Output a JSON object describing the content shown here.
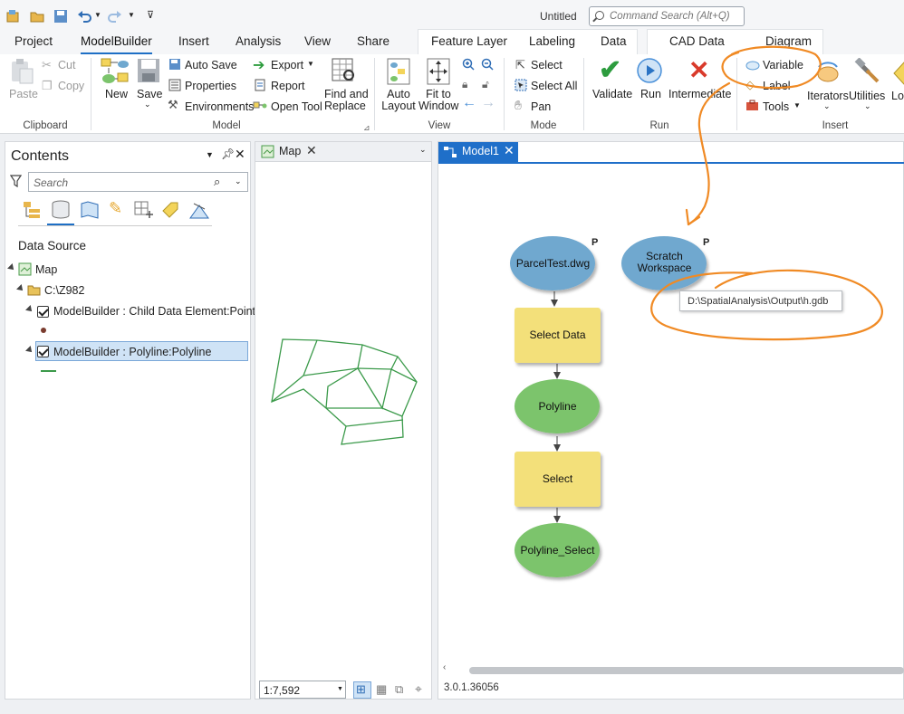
{
  "window": {
    "title": "Untitled",
    "command_search_placeholder": "Command Search (Alt+Q)"
  },
  "tabs": [
    "Project",
    "ModelBuilder",
    "Insert",
    "Analysis",
    "View",
    "Share"
  ],
  "contextual_tabs": {
    "feature_layer": "Feature Layer",
    "labeling": "Labeling",
    "data": "Data",
    "cad_data": "CAD Data",
    "diagram": "Diagram"
  },
  "ribbon": {
    "clipboard": {
      "paste": "Paste",
      "cut": "Cut",
      "copy": "Copy",
      "group": "Clipboard"
    },
    "model": {
      "new": "New",
      "save": "Save",
      "auto_save": "Auto Save",
      "properties": "Properties",
      "environments": "Environments",
      "export": "Export",
      "report": "Report",
      "open_tool": "Open Tool",
      "find_replace_1": "Find and",
      "find_replace_2": "Replace",
      "group": "Model"
    },
    "view": {
      "auto_layout_1": "Auto",
      "auto_layout_2": "Layout",
      "fit_1": "Fit to",
      "fit_2": "Window",
      "group": "View"
    },
    "mode": {
      "select": "Select",
      "select_all": "Select All",
      "pan": "Pan",
      "group": "Mode"
    },
    "run": {
      "validate": "Validate",
      "run": "Run",
      "intermediate": "Intermediate",
      "group": "Run"
    },
    "insert": {
      "variable": "Variable",
      "label": "Label",
      "tools": "Tools",
      "iterators": "Iterators",
      "utilities": "Utilities",
      "logical": "Log",
      "group": "Insert"
    }
  },
  "contents": {
    "title": "Contents",
    "search_placeholder": "Search",
    "section": "Data Source",
    "map": "Map",
    "folder": "C:\\Z982",
    "layer1": "ModelBuilder : Child  Data Element:Point",
    "layer2": "ModelBuilder : Polyline:Polyline"
  },
  "map_view": {
    "tab": "Map",
    "scale": "1:7,592"
  },
  "model": {
    "tab": "Model1",
    "nodes": {
      "parcel": "ParcelTest.dwg",
      "scratch_1": "Scratch",
      "scratch_2": "Workspace",
      "select_data": "Select Data",
      "polyline": "Polyline",
      "select": "Select",
      "polyline_select": "Polyline_Select",
      "p_flag": "P"
    },
    "tooltip": "D:\\SpatialAnalysis\\Output\\h.gdb",
    "version": "3.0.1.36056"
  },
  "colors": {
    "accent": "#1e6fc5",
    "data_node": "#6fa8cf",
    "tool_node": "#f3e07a",
    "output_node": "#7cc46c",
    "annotation": "#f08a24"
  }
}
